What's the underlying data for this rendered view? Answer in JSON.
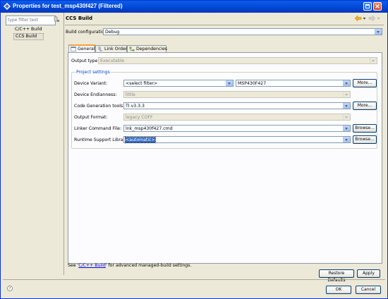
{
  "window": {
    "title": "Properties for test_msp430f427 (Filtered)"
  },
  "filter": {
    "placeholder": "type filter text"
  },
  "tree": {
    "items": [
      {
        "label": "C/C++ Build"
      },
      {
        "label": "CCS Build"
      }
    ]
  },
  "page": {
    "title": "CCS Build",
    "build_configuration_label": "Build configuration:",
    "build_configuration_value": "Debug"
  },
  "tabs": [
    {
      "label": "General"
    },
    {
      "label": "Link Order"
    },
    {
      "label": "Dependencies"
    }
  ],
  "general": {
    "output_type_label": "Output type:",
    "output_type_value": "Executable",
    "group_title": "Project settings",
    "device_variant_label": "Device Variant:",
    "device_variant_filter": "<select filter>",
    "device_variant_value": "MSP430F427",
    "device_endianness_label": "Device Endianness:",
    "device_endianness_value": "little",
    "codegen_label": "Code Generation tools:",
    "codegen_value": "TI v3.3.3",
    "output_format_label": "Output Format:",
    "output_format_value": "legacy COFF",
    "linker_cmd_label": "Linker Command File:",
    "linker_cmd_value": "lnk_msp430f427.cmd",
    "rts_label": "Runtime Support Library:",
    "rts_value": "<automatic>",
    "more_label": "More...",
    "browse_label": "Browse..."
  },
  "footer": {
    "see_prefix": "See '",
    "see_link": "C/C++ Build",
    "see_suffix": "' for advanced managed-build settings.",
    "restore_defaults": "Restore Defaults",
    "apply": "Apply",
    "ok": "OK",
    "cancel": "Cancel"
  },
  "colors": {
    "titlebar": "#0a5ee8",
    "link": "#0000ee",
    "tab_accent": "#f2a037",
    "selection": "#316ac5"
  }
}
